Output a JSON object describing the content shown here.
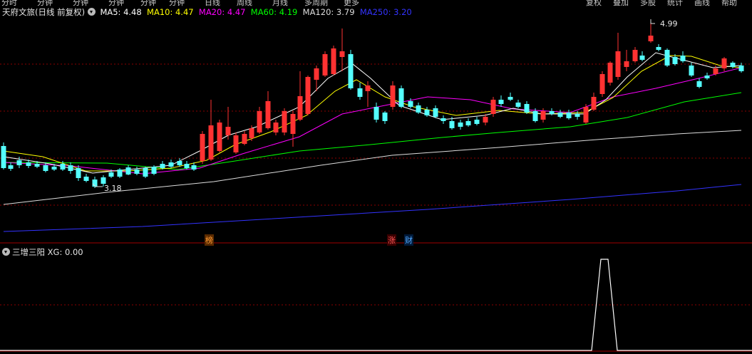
{
  "toolbar": {
    "items": [
      "分时",
      "分钟",
      "分钟",
      "分钟",
      "分钟",
      "分钟",
      "日线",
      "周线",
      "月线",
      "多周期",
      "更多"
    ],
    "right_items": [
      "复权",
      "叠加",
      "多股",
      "统计",
      "画线",
      "帮助"
    ]
  },
  "main": {
    "stock_name": "天府文旅",
    "period": "(日线 前复权)",
    "ma": [
      {
        "label": "MA5: 4.48",
        "color": "#ffffff"
      },
      {
        "label": "MA10: 4.47",
        "color": "#ffff00"
      },
      {
        "label": "MA20: 4.47",
        "color": "#ff00ff"
      },
      {
        "label": "MA60: 4.19",
        "color": "#00ff00"
      },
      {
        "label": "MA120: 3.79",
        "color": "#dddddd"
      },
      {
        "label": "MA250: 3.20",
        "color": "#3333ff"
      }
    ],
    "high_label": "4.99",
    "low_label": "3.18",
    "event_tags": [
      {
        "text": "榜",
        "color": "#ff9933",
        "bg": "#5a2a00"
      },
      {
        "text": "涨",
        "color": "#ff5555",
        "bg": "#3a0000"
      },
      {
        "text": "财",
        "color": "#55aaff",
        "bg": "#001a3a"
      }
    ]
  },
  "indicator": {
    "name": "三增三阳",
    "value": "XG: 0.00"
  },
  "colors": {
    "up": "#ff3232",
    "down": "#54ffff",
    "ma5": "#ffffff",
    "ma10": "#ffff00",
    "ma20": "#ff00ff",
    "ma60": "#00ff00",
    "ma120": "#dddddd",
    "ma250": "#3333ff",
    "grid": "#8b0000"
  }
}
